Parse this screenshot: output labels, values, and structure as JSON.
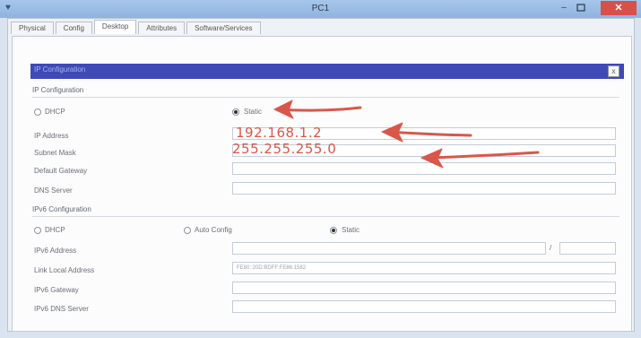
{
  "window": {
    "title": "PC1",
    "minimize": "–",
    "maximize": "▫",
    "close": "✕"
  },
  "tabs": [
    "Physical",
    "Config",
    "Desktop",
    "Attributes",
    "Software/Services"
  ],
  "panel": {
    "header": "IP Configuration",
    "close": "x"
  },
  "ipv4": {
    "section": "IP Configuration",
    "dhcp_label": "DHCP",
    "static_label": "Static",
    "selected": "Static",
    "fields": [
      {
        "label": "IP Address",
        "value": "192.168.1.2"
      },
      {
        "label": "Subnet Mask",
        "value": "255.255.255.0"
      },
      {
        "label": "Default Gateway",
        "value": ""
      },
      {
        "label": "DNS Server",
        "value": ""
      }
    ]
  },
  "ipv6": {
    "section": "IPv6 Configuration",
    "dhcp_label": "DHCP",
    "auto_label": "Auto Config",
    "static_label": "Static",
    "selected": "Static",
    "prefix_separator": "/",
    "fields": [
      {
        "label": "IPv6 Address",
        "value": "",
        "prefix": ""
      },
      {
        "label": "Link Local Address",
        "value": "FE80::20D:BDFF:FE86:1582"
      },
      {
        "label": "IPv6 Gateway",
        "value": ""
      },
      {
        "label": "IPv6 DNS Server",
        "value": ""
      }
    ]
  },
  "annotations": {
    "color": "#d9574a"
  }
}
